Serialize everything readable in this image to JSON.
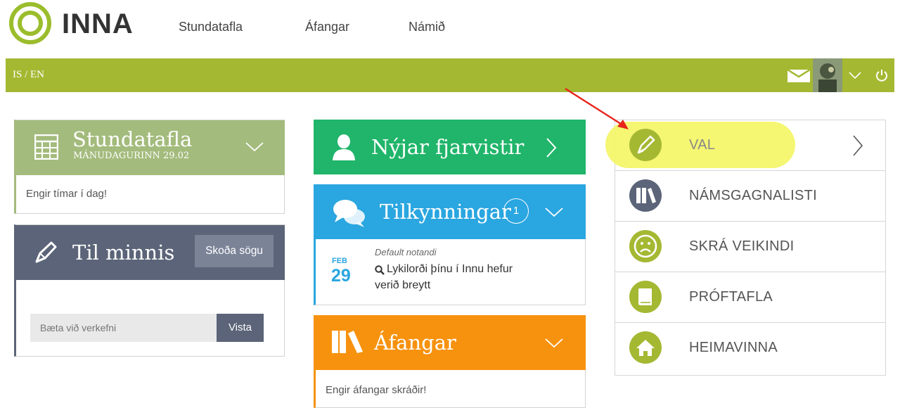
{
  "header": {
    "logo": "INNA",
    "nav": [
      "Stundatafla",
      "Áfangar",
      "Námið"
    ]
  },
  "topbar": {
    "language": "IS / EN",
    "icons": [
      "mail-icon",
      "avatar",
      "chevron-down-icon",
      "power-icon"
    ]
  },
  "timetable": {
    "title": "Stundatafla",
    "date": "MÁNUDAGURINN 29.02",
    "empty": "Engir tímar í dag!"
  },
  "notes": {
    "title": "Til minnis",
    "history_button": "Skoða sögu",
    "input_placeholder": "Bæta við verkefni",
    "save_button": "Vista"
  },
  "absences": {
    "title": "Nýjar fjarvistir"
  },
  "announcements": {
    "title": "Tilkynningar",
    "count": "1",
    "items": [
      {
        "month": "FEB",
        "day": "29",
        "author": "Default notandi",
        "text_line1": "Lykilorði þínu í Innu hefur",
        "text_line2": "verið breytt"
      }
    ]
  },
  "courses": {
    "title": "Áfangar",
    "empty": "Engir áfangar skráðir!"
  },
  "menu": {
    "items": [
      {
        "label": "VAL",
        "icon": "pencil-icon"
      },
      {
        "label": "NÁMSGAGNALISTI",
        "icon": "books-icon"
      },
      {
        "label": "SKRÁ VEIKINDI",
        "icon": "sad-face-icon"
      },
      {
        "label": "PRÓFTAFLA",
        "icon": "book-icon"
      },
      {
        "label": "HEIMAVINNA",
        "icon": "home-icon"
      }
    ]
  },
  "colors": {
    "brand_green": "#a5b832",
    "timetable_green": "#a3bb7c",
    "notes_slate": "#5b6478",
    "absences_green": "#20b56a",
    "announcements_blue": "#2aa6e0",
    "courses_orange": "#f7920f",
    "highlight_yellow": "#f4f56a",
    "arrow_red": "#e8241b"
  }
}
